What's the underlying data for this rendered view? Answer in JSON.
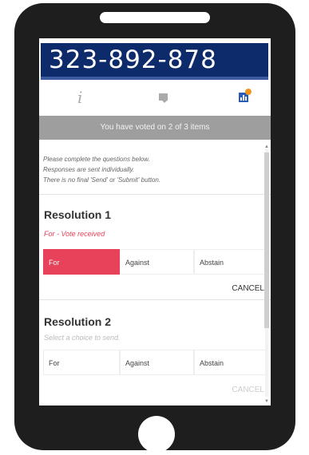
{
  "meeting_code": "323-892-878",
  "tabs": [
    {
      "name": "info",
      "icon": "info-icon"
    },
    {
      "name": "messages",
      "icon": "chat-icon"
    },
    {
      "name": "voting",
      "icon": "bar-chart-icon",
      "active": true,
      "notification": true
    }
  ],
  "status_message": "You have voted on 2 of 3 items",
  "instructions": [
    "Please complete the questions below.",
    "Responses are sent individually.",
    "There is no final 'Send' or 'Submit' button."
  ],
  "resolutions": [
    {
      "title": "Resolution 1",
      "status": "For - Vote received",
      "status_color": "#e8425a",
      "options": [
        "For",
        "Against",
        "Abstain"
      ],
      "selected": "For",
      "cancel_label": "CANCEL",
      "cancel_enabled": true
    },
    {
      "title": "Resolution 2",
      "status": "Select a choice to send.",
      "status_color": "#bbbbbb",
      "options": [
        "For",
        "Against",
        "Abstain"
      ],
      "selected": null,
      "cancel_label": "CANCEL",
      "cancel_enabled": false
    }
  ],
  "colors": {
    "code_bar": "#0d2b6b",
    "accent": "#e8425a",
    "status_bar": "#9e9e9e",
    "notification": "#f2941b"
  }
}
